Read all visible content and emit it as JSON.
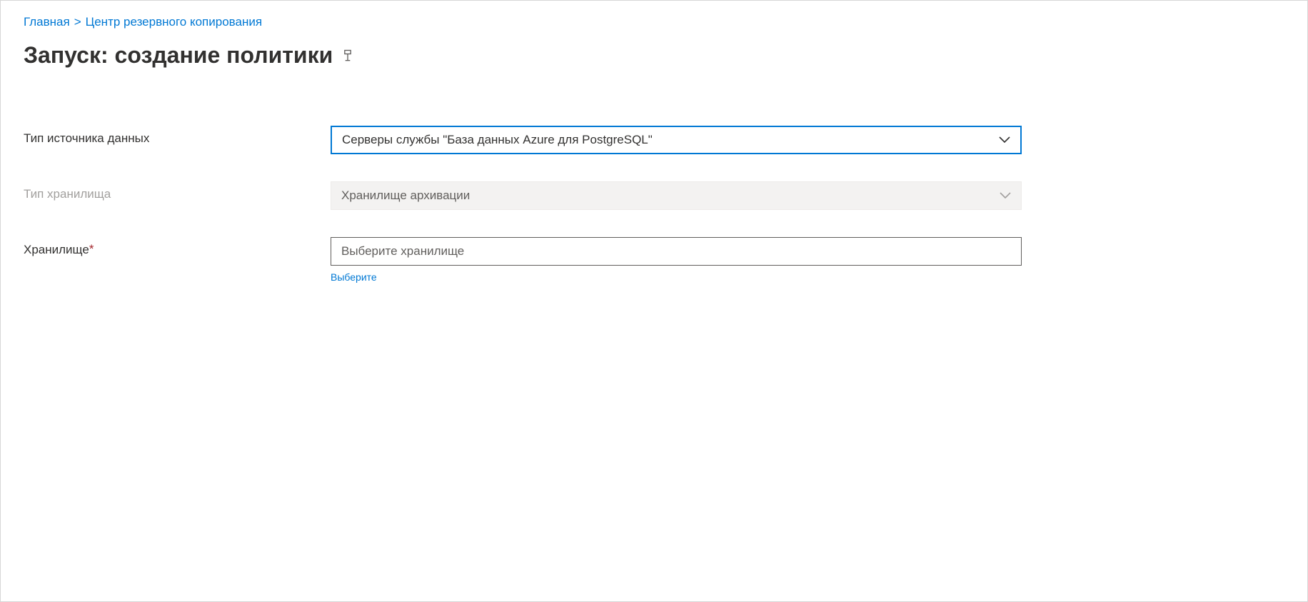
{
  "breadcrumb": {
    "home": "Главная",
    "sep": ">",
    "backup_center": "Центр резервного копирования"
  },
  "page_title": "Запуск: создание политики",
  "form": {
    "datasource_type": {
      "label": "Тип источника данных",
      "value": "Серверы службы \"База данных Azure для PostgreSQL\""
    },
    "vault_type": {
      "label": "Тип хранилища",
      "value": "Хранилище архивации"
    },
    "vault": {
      "label": "Хранилище",
      "placeholder": "Выберите хранилище",
      "helper": "Выберите"
    }
  }
}
